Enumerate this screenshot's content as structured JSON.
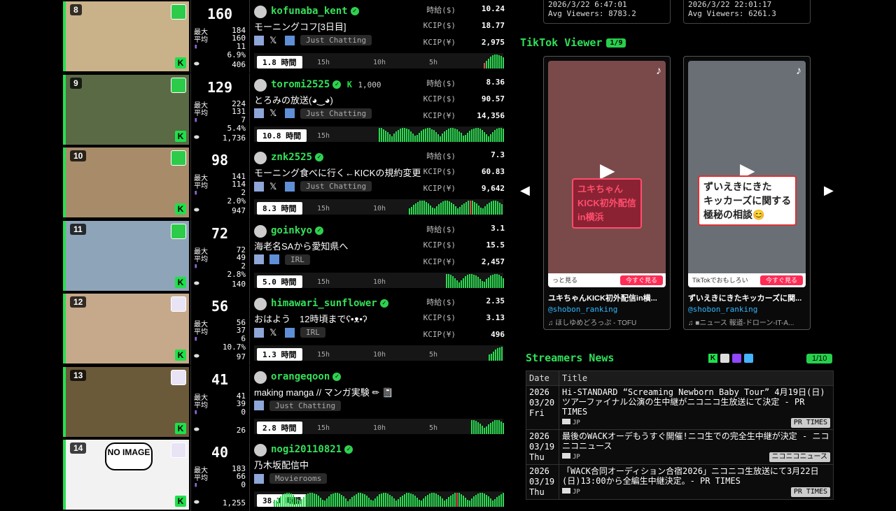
{
  "top_stats": [
    {
      "date": "2026/3/22 6:47:01",
      "avg": "Avg Viewers: 8783.2"
    },
    {
      "date": "2026/3/22 22:01:17",
      "avg": "Avg Viewers: 6261.3"
    }
  ],
  "labels": {
    "max": "最大",
    "avg": "平均",
    "hourly": "時給($)",
    "kcip_usd": "KCIP($)",
    "kcip_jpy": "KCIP(¥)",
    "t15": "15h",
    "t10": "10h",
    "t5": "5h"
  },
  "streams": [
    {
      "rank": "8",
      "viewers": "160",
      "max": "184",
      "avg": "160",
      "subs": "11",
      "pct": "6.9%",
      "follows": "406",
      "name": "kofunaba_kent",
      "kick_subs": "",
      "title": "モーニングコフ[3日目]",
      "category": "Just Chatting",
      "hourly": "10.24",
      "kcip_usd": "18.77",
      "kcip_jpy": "2,975",
      "duration": "1.8 時間",
      "ticks": [
        "15h",
        "10h",
        "5h"
      ],
      "fill": 0.08
    },
    {
      "rank": "9",
      "viewers": "129",
      "max": "224",
      "avg": "131",
      "subs": "7",
      "pct": "5.4%",
      "follows": "1,736",
      "name": "toromi2525",
      "kick_subs": "1,000",
      "title": "とろみの放送(◕‿◕)",
      "category": "Just Chatting",
      "hourly": "8.36",
      "kcip_usd": "90.57",
      "kcip_jpy": "14,356",
      "duration": "10.8 時間",
      "ticks": [
        "15h"
      ],
      "fill": 0.5
    },
    {
      "rank": "10",
      "viewers": "98",
      "max": "141",
      "avg": "114",
      "subs": "2",
      "pct": "2.0%",
      "follows": "947",
      "name": "znk2525",
      "kick_subs": "",
      "title": "モーニング食べに行く←KICKの規約変更",
      "category": "Just Chatting",
      "hourly": "7.3",
      "kcip_usd": "60.83",
      "kcip_jpy": "9,642",
      "duration": "8.3 時間",
      "ticks": [
        "15h",
        "10h"
      ],
      "fill": 0.38
    },
    {
      "rank": "11",
      "viewers": "72",
      "max": "72",
      "avg": "49",
      "subs": "2",
      "pct": "2.8%",
      "follows": "140",
      "name": "goinkyo",
      "kick_subs": "",
      "title": "海老名SAから愛知県へ",
      "category": "IRL",
      "hourly": "3.1",
      "kcip_usd": "15.5",
      "kcip_jpy": "2,457",
      "duration": "5.0 時間",
      "ticks": [
        "15h",
        "10h"
      ],
      "fill": 0.23
    },
    {
      "rank": "12",
      "viewers": "56",
      "max": "56",
      "avg": "37",
      "subs": "6",
      "pct": "10.7%",
      "follows": "97",
      "name": "himawari_sunflower",
      "kick_subs": "",
      "title": "おはよう　12時頃までʕ•ᴥ•ʔ",
      "category": "IRL",
      "hourly": "2.35",
      "kcip_usd": "3.13",
      "kcip_jpy": "496",
      "duration": "1.3 時間",
      "ticks": [
        "15h",
        "10h",
        "5h"
      ],
      "fill": 0.06
    },
    {
      "rank": "13",
      "viewers": "41",
      "max": "41",
      "avg": "39",
      "subs": "0",
      "pct": "",
      "follows": "26",
      "name": "orangeqoon",
      "kick_subs": "",
      "title": "making manga // マンガ実験 ✏ 📓",
      "category": "Just Chatting",
      "hourly": "",
      "kcip_usd": "",
      "kcip_jpy": "",
      "duration": "2.8 時間",
      "ticks": [
        "15h",
        "10h",
        "5h"
      ],
      "fill": 0.13
    },
    {
      "rank": "14",
      "viewers": "40",
      "max": "183",
      "avg": "66",
      "subs": "0",
      "pct": "",
      "follows": "1,255",
      "name": "nogi20110821",
      "kick_subs": "",
      "title": "乃木坂配信中",
      "category": "Movierooms",
      "hourly": "",
      "kcip_usd": "",
      "kcip_jpy": "",
      "duration": "38.3 時間",
      "ticks": [],
      "fill": 0.92
    }
  ],
  "no_image": "NO IMAGE",
  "tiktok": {
    "title": "TikTok Viewer",
    "page": "1/9",
    "prev": "◀",
    "next": "▶",
    "cards": [
      {
        "overlay": "ユキちゃん\nKICK初外配信\nin横浜",
        "caption": "ユキちゃんKICK初外配信in横...",
        "handle": "@shobon_ranking",
        "music": "♫ ほしゆめどろっぷ - TOFU",
        "btn": "今すぐ見る",
        "more": "っと見る"
      },
      {
        "overlay": "ずいえきにきた\nキッカーズに関する\n極秘の相談😊",
        "caption": "ずいえきにきたキッカーズに関...",
        "handle": "@shobon_ranking",
        "music": "♫ ■ニュース 報道-ドローン-IT-A...",
        "btn": "今すぐ見る",
        "more": "TikTokでおもしろい"
      }
    ]
  },
  "news": {
    "title": "Streamers News",
    "page": "1/10",
    "col_date": "Date",
    "col_title": "Title",
    "items": [
      {
        "year": "2026",
        "md": "03/20",
        "dow": "Fri",
        "title": "Hi-STANDARD “Screaming Newborn Baby Tour” 4月19日(日)ツアーファイナル公演の生中継がニコニコ生放送にて決定 - PR TIMES",
        "lang": "JP",
        "source": "PR TIMES"
      },
      {
        "year": "2026",
        "md": "03/19",
        "dow": "Thu",
        "title": "最後のWACKオーデもうすぐ開催!ニコ生での完全生中継が決定 - ニコニコニュース",
        "lang": "JP",
        "source": "ニコニコニュース"
      },
      {
        "year": "2026",
        "md": "03/19",
        "dow": "Thu",
        "title": "「WACK合同オーディション合宿2026」ニコニコ生放送にて3月22日(日)13:00から全編生中継決定。- PR TIMES",
        "lang": "JP",
        "source": "PR TIMES"
      }
    ]
  },
  "colors": {
    "accent": "#2fe05a",
    "kick": "#1ee04a",
    "link": "#2fb8ff"
  }
}
